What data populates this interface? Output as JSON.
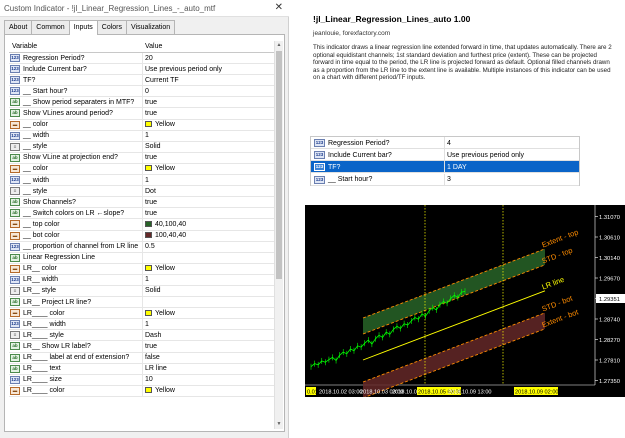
{
  "window": {
    "title": "Custom Indicator - !jl_Linear_Regression_Lines_-_auto_mtf",
    "close_glyph": "✕"
  },
  "tabs": [
    "About",
    "Common",
    "Inputs",
    "Colors",
    "Visualization"
  ],
  "active_tab": "Inputs",
  "grid": {
    "col_variable": "Variable",
    "col_value": "Value",
    "rows": [
      {
        "icon": "123",
        "kind": "int",
        "name": "Regression Period?",
        "value": "20"
      },
      {
        "icon": "123",
        "kind": "int",
        "name": "Include Current bar?",
        "value": "Use previous period only"
      },
      {
        "icon": "123",
        "kind": "int",
        "name": "TF?",
        "value": "Current TF"
      },
      {
        "icon": "123",
        "kind": "int",
        "name": "__ Start hour?",
        "value": "0"
      },
      {
        "icon": "ab",
        "kind": "bool",
        "name": "__ Show period separaters in MTF?",
        "value": "true"
      },
      {
        "icon": "ab",
        "kind": "bool",
        "name": "Show VLines around period?",
        "value": "true"
      },
      {
        "icon": "▬",
        "kind": "color",
        "name": "__ color",
        "value": "Yellow",
        "swatch": "#ffff00"
      },
      {
        "icon": "123",
        "kind": "int",
        "name": "__ width",
        "value": "1"
      },
      {
        "icon": "≡",
        "kind": "line",
        "name": "__ style",
        "value": "Solid"
      },
      {
        "icon": "ab",
        "kind": "bool",
        "name": "Show VLine at projection end?",
        "value": "true"
      },
      {
        "icon": "▬",
        "kind": "color",
        "name": "__ color",
        "value": "Yellow",
        "swatch": "#ffff00"
      },
      {
        "icon": "123",
        "kind": "int",
        "name": "__ width",
        "value": "1"
      },
      {
        "icon": "≡",
        "kind": "line",
        "name": "__ style",
        "value": "Dot"
      },
      {
        "icon": "ab",
        "kind": "bool",
        "name": "Show Channels?",
        "value": "true"
      },
      {
        "icon": "ab",
        "kind": "bool",
        "name": "__ Switch colors on LR ←slope?",
        "value": "true"
      },
      {
        "icon": "▬",
        "kind": "color",
        "name": "__ top color",
        "value": "40,100,40",
        "swatch": "#286428"
      },
      {
        "icon": "▬",
        "kind": "color",
        "name": "__ bot color",
        "value": "100,40,40",
        "swatch": "#642828"
      },
      {
        "icon": "123",
        "kind": "int",
        "name": "__ proportion of channel from LR line",
        "value": "0.5"
      },
      {
        "icon": "ab",
        "kind": "bool",
        "name": "Linear Regression Line",
        "value": ""
      },
      {
        "icon": "▬",
        "kind": "color",
        "name": "LR__ color",
        "value": "Yellow",
        "swatch": "#ffff00"
      },
      {
        "icon": "123",
        "kind": "int",
        "name": "LR__ width",
        "value": "1"
      },
      {
        "icon": "≡",
        "kind": "line",
        "name": "LR__ style",
        "value": "Solid"
      },
      {
        "icon": "ab",
        "kind": "bool",
        "name": "LR__ Project LR line?",
        "value": ""
      },
      {
        "icon": "▬",
        "kind": "color",
        "name": "LR____ color",
        "value": "Yellow",
        "swatch": "#ffff00"
      },
      {
        "icon": "123",
        "kind": "int",
        "name": "LR____ width",
        "value": "1"
      },
      {
        "icon": "≡",
        "kind": "line",
        "name": "LR____ style",
        "value": "Dash"
      },
      {
        "icon": "ab",
        "kind": "bool",
        "name": "LR__ Show LR label?",
        "value": "true"
      },
      {
        "icon": "ab",
        "kind": "bool",
        "name": "LR____ label at end of extension?",
        "value": "false"
      },
      {
        "icon": "ab",
        "kind": "bool",
        "name": "LR____ text",
        "value": "LR line"
      },
      {
        "icon": "123",
        "kind": "int",
        "name": "LR____ size",
        "value": "10"
      },
      {
        "icon": "▬",
        "kind": "color",
        "name": "LR____ color",
        "value": "Yellow",
        "swatch": "#ffff00"
      }
    ]
  },
  "doc": {
    "title": "!jl_Linear_Regression_Lines_auto 1.00",
    "author": "jeanlouie, forexfactory.com",
    "description": "This indicator draws a linear regression line extended forward in time, that updates automatically. There are 2 optional equidistant channels; 1st standard deviation and furthest price (extent). These can be projected forward in time equal to the period, the LR line is projected forward as default. Optional filled channels drawn as a proportion from the LR line to the extent line is available. Multiple instances of this indicator can be used on a chart with different period/TF inputs."
  },
  "mini_table": [
    {
      "icon": "123",
      "name": "Regression Period?",
      "value": "4"
    },
    {
      "icon": "123",
      "name": "Include Current bar?",
      "value": "Use previous period only"
    },
    {
      "icon": "123",
      "name": "TF?",
      "value": "1 DAY",
      "selected": true
    },
    {
      "icon": "123",
      "name": "__ Start hour?",
      "value": "3"
    }
  ],
  "chart_data": {
    "type": "line",
    "price_labels": [
      "1.31070",
      "1.30610",
      "1.30140",
      "1.29670",
      "1.29351",
      "1.28740",
      "1.28270",
      "1.27810",
      "1.27350"
    ],
    "current_price": "1.29351",
    "time_labels": [
      "0.01",
      "2018.10.02 03:00",
      "2018.10.03 03:00",
      "2018.10.04 03:00",
      "2018.10.05 03:00",
      "2018.10.09 13:00",
      "2018.10.09 02:00"
    ],
    "line_labels": [
      "Extent - top",
      "STD - top",
      "LR line",
      "STD - bot",
      "Extent - bot"
    ],
    "colors": {
      "top_fill": "#286428",
      "bot_fill": "#642828",
      "price": "#00ff00",
      "vline": "#ffff00",
      "channel": "#ff8c00",
      "lr": "#ffff00"
    },
    "price_series": [
      1.2765,
      1.2772,
      1.2769,
      1.2778,
      1.2775,
      1.2781,
      1.2786,
      1.2779,
      1.2791,
      1.2798,
      1.2794,
      1.2805,
      1.2801,
      1.2812,
      1.2809,
      1.2818,
      1.2825,
      1.2816,
      1.2828,
      1.2836,
      1.2831,
      1.2843,
      1.2838,
      1.2849,
      1.2856,
      1.2851,
      1.2862,
      1.2859,
      1.2868,
      1.2876,
      1.2872,
      1.2884,
      1.2879,
      1.2891,
      1.2898,
      1.2893,
      1.2905,
      1.2912,
      1.2908,
      1.2919,
      1.2926,
      1.2921,
      1.2933,
      1.2935
    ]
  }
}
